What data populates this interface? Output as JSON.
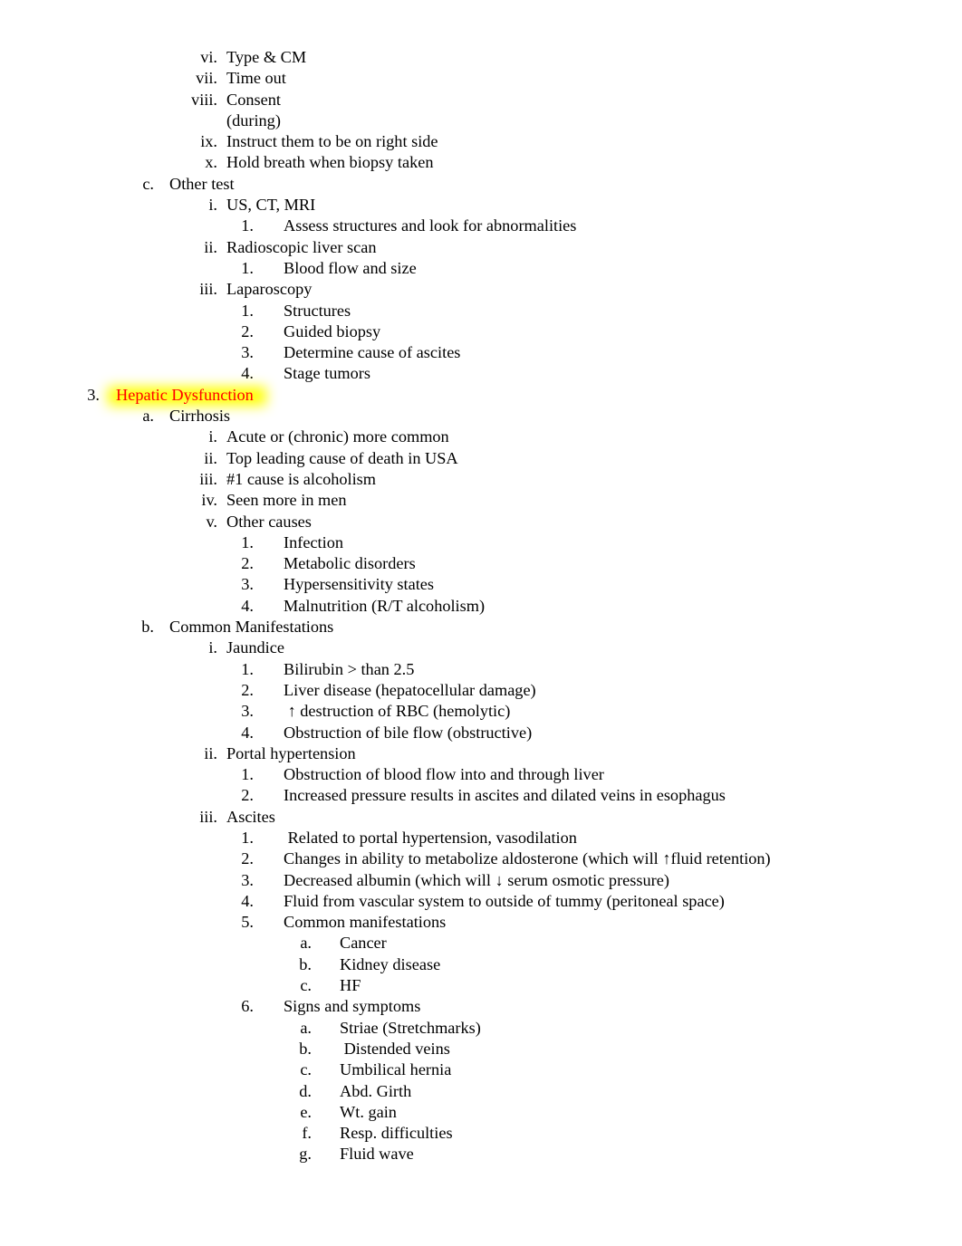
{
  "document": {
    "page_background": "#ffffff",
    "text_color": "#000000",
    "highlight_color": "#ffff00",
    "highlight_text_color": "#ff0000"
  },
  "outline": [
    {
      "level": 3,
      "marker": "vi.",
      "text": "Type & CM"
    },
    {
      "level": 3,
      "marker": "vii.",
      "text": "Time out"
    },
    {
      "level": 3,
      "marker": "viii.",
      "text": "Consent"
    },
    {
      "level": 3,
      "marker": "",
      "text": "(during)",
      "continuation": true
    },
    {
      "level": 3,
      "marker": "ix.",
      "text": "Instruct them to be on right side"
    },
    {
      "level": 3,
      "marker": "x.",
      "text": "Hold breath when biopsy taken"
    },
    {
      "level": 2,
      "marker": "c.",
      "text": "Other test"
    },
    {
      "level": 3,
      "marker": "i.",
      "text": "US, CT, MRI"
    },
    {
      "level": 4,
      "marker": "1.",
      "text": "Assess structures and look for abnormalities"
    },
    {
      "level": 3,
      "marker": "ii.",
      "text": "Radioscopic liver scan"
    },
    {
      "level": 4,
      "marker": "1.",
      "text": "Blood flow and size"
    },
    {
      "level": 3,
      "marker": "iii.",
      "text": "Laparoscopy"
    },
    {
      "level": 4,
      "marker": "1.",
      "text": "Structures"
    },
    {
      "level": 4,
      "marker": "2.",
      "text": "Guided biopsy"
    },
    {
      "level": 4,
      "marker": "3.",
      "text": "Determine cause of ascites"
    },
    {
      "level": 4,
      "marker": "4.",
      "text": "Stage tumors"
    },
    {
      "level": 1,
      "marker": "3.",
      "text": "Hepatic Dysfunction",
      "highlighted": true
    },
    {
      "level": 2,
      "marker": "a.",
      "text": "Cirrhosis"
    },
    {
      "level": 3,
      "marker": "i.",
      "text": "Acute or (chronic) more common"
    },
    {
      "level": 3,
      "marker": "ii.",
      "text": "Top leading cause of death in USA"
    },
    {
      "level": 3,
      "marker": "iii.",
      "text": "#1 cause is alcoholism"
    },
    {
      "level": 3,
      "marker": "iv.",
      "text": "Seen more in men"
    },
    {
      "level": 3,
      "marker": "v.",
      "text": "Other causes"
    },
    {
      "level": 4,
      "marker": "1.",
      "text": "Infection"
    },
    {
      "level": 4,
      "marker": "2.",
      "text": "Metabolic disorders"
    },
    {
      "level": 4,
      "marker": "3.",
      "text": "Hypersensitivity states"
    },
    {
      "level": 4,
      "marker": "4.",
      "text": "Malnutrition (R/T alcoholism)"
    },
    {
      "level": 2,
      "marker": "b.",
      "text": "Common Manifestations"
    },
    {
      "level": 3,
      "marker": "i.",
      "text": "Jaundice"
    },
    {
      "level": 4,
      "marker": "1.",
      "text": "Bilirubin > than 2.5"
    },
    {
      "level": 4,
      "marker": "2.",
      "text": "Liver disease (hepatocellular damage)"
    },
    {
      "level": 4,
      "marker": "3.",
      "text": " ↑ destruction of RBC (hemolytic)"
    },
    {
      "level": 4,
      "marker": "4.",
      "text": "Obstruction of bile flow (obstructive)"
    },
    {
      "level": 3,
      "marker": "ii.",
      "text": "Portal hypertension"
    },
    {
      "level": 4,
      "marker": "1.",
      "text": "Obstruction of blood flow into and through liver"
    },
    {
      "level": 4,
      "marker": "2.",
      "text": "Increased pressure results in ascites and dilated veins in esophagus"
    },
    {
      "level": 3,
      "marker": "iii.",
      "text": "Ascites"
    },
    {
      "level": 4,
      "marker": "1.",
      "text": " Related to portal hypertension, vasodilation"
    },
    {
      "level": 4,
      "marker": "2.",
      "text": "Changes in ability to metabolize aldosterone (which will ↑fluid retention)"
    },
    {
      "level": 4,
      "marker": "3.",
      "text": "Decreased albumin (which will ↓ serum osmotic pressure)"
    },
    {
      "level": 4,
      "marker": "4.",
      "text": "Fluid from vascular system to outside of tummy (peritoneal space)"
    },
    {
      "level": 4,
      "marker": "5.",
      "text": "Common manifestations"
    },
    {
      "level": 5,
      "marker": "a.",
      "text": "Cancer"
    },
    {
      "level": 5,
      "marker": "b.",
      "text": "Kidney disease"
    },
    {
      "level": 5,
      "marker": "c.",
      "text": "HF"
    },
    {
      "level": 4,
      "marker": "6.",
      "text": "Signs and symptoms"
    },
    {
      "level": 5,
      "marker": "a.",
      "text": "Striae (Stretchmarks)"
    },
    {
      "level": 5,
      "marker": "b.",
      "text": " Distended veins"
    },
    {
      "level": 5,
      "marker": "c.",
      "text": "Umbilical hernia"
    },
    {
      "level": 5,
      "marker": "d.",
      "text": "Abd. Girth"
    },
    {
      "level": 5,
      "marker": "e.",
      "text": "Wt. gain"
    },
    {
      "level": 5,
      "marker": "f.",
      "text": "Resp. difficulties"
    },
    {
      "level": 5,
      "marker": "g.",
      "text": "Fluid wave"
    }
  ]
}
